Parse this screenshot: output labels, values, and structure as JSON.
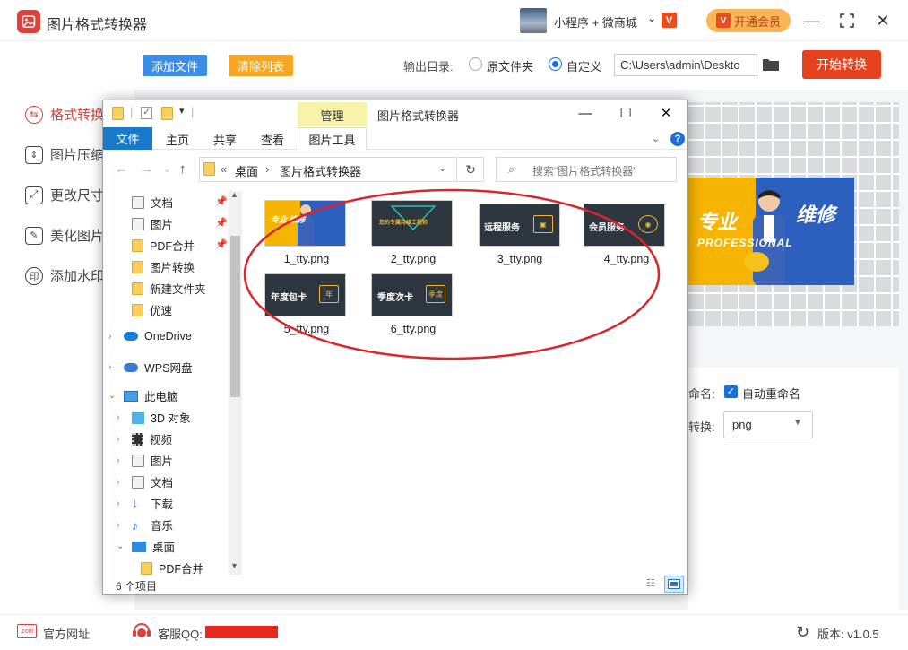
{
  "app": {
    "title": "图片格式转换器",
    "mini_link": "小程序 + 微商城",
    "vip_label": "开通会员",
    "v_badge": "V"
  },
  "toolbar": {
    "add_files": "添加文件",
    "clear_list": "清除列表",
    "output_label": "输出目录:",
    "radio_original": "原文件夹",
    "radio_custom": "自定义",
    "output_path": "C:\\Users\\admin\\Deskto",
    "start": "开始转换"
  },
  "sidebar": {
    "items": [
      {
        "label": "格式转换",
        "icon": "convert-icon"
      },
      {
        "label": "图片压缩",
        "icon": "compress-icon"
      },
      {
        "label": "更改尺寸",
        "icon": "resize-icon"
      },
      {
        "label": "美化图片",
        "icon": "beautify-icon"
      },
      {
        "label": "添加水印",
        "icon": "watermark-icon"
      }
    ]
  },
  "preview": {
    "text_left": "专业",
    "text_right": "维修",
    "text_sub": "PROFESSIONAL"
  },
  "settings": {
    "rename_label": "命名:",
    "rename_option": "自动重命名",
    "format_label": "转换:",
    "format_value": "png"
  },
  "footer": {
    "site_icon_text": ".com",
    "site_link": "官方网址",
    "qq_label": "客服QQ:",
    "version": "版本: v1.0.5"
  },
  "explorer": {
    "manage_tab": "管理",
    "title": "图片格式转换器",
    "tabs": [
      "文件",
      "主页",
      "共享",
      "查看",
      "图片工具"
    ],
    "breadcrumb": [
      "桌面",
      "图片格式转换器"
    ],
    "breadcrumb_prefix": "«",
    "search_placeholder": "搜索\"图片格式转换器\"",
    "nav": {
      "quick": [
        "文档",
        "图片",
        "PDF合并",
        "图片转换",
        "新建文件夹",
        "优速"
      ],
      "onedrive": "OneDrive",
      "wps": "WPS网盘",
      "this_pc": "此电脑",
      "pc_items": [
        "3D 对象",
        "视频",
        "图片",
        "文档",
        "下载",
        "音乐",
        "桌面"
      ],
      "desktop_child": "PDF合并"
    },
    "files": [
      {
        "name": "1_tty.png",
        "thumb_text": "专业 维修"
      },
      {
        "name": "2_tty.png",
        "thumb_text": "您的专属持续工程师"
      },
      {
        "name": "3_tty.png",
        "thumb_text": "远程服务"
      },
      {
        "name": "4_tty.png",
        "thumb_text": "会员服务"
      },
      {
        "name": "5_tty.png",
        "thumb_text": "年度包卡",
        "badge": "年"
      },
      {
        "name": "6_tty.png",
        "thumb_text": "季度次卡",
        "badge": "季度"
      }
    ],
    "status": "6 个项目"
  },
  "colors": {
    "accent_red": "#e0413a",
    "start_button": "#e8411e",
    "add_button": "#3c8de8",
    "clear_button": "#f5a623",
    "vip": "#f9b556",
    "ribbon_file": "#1979ca",
    "manage_tab": "#f6f2a8",
    "annotation_ellipse": "#d9262b"
  }
}
